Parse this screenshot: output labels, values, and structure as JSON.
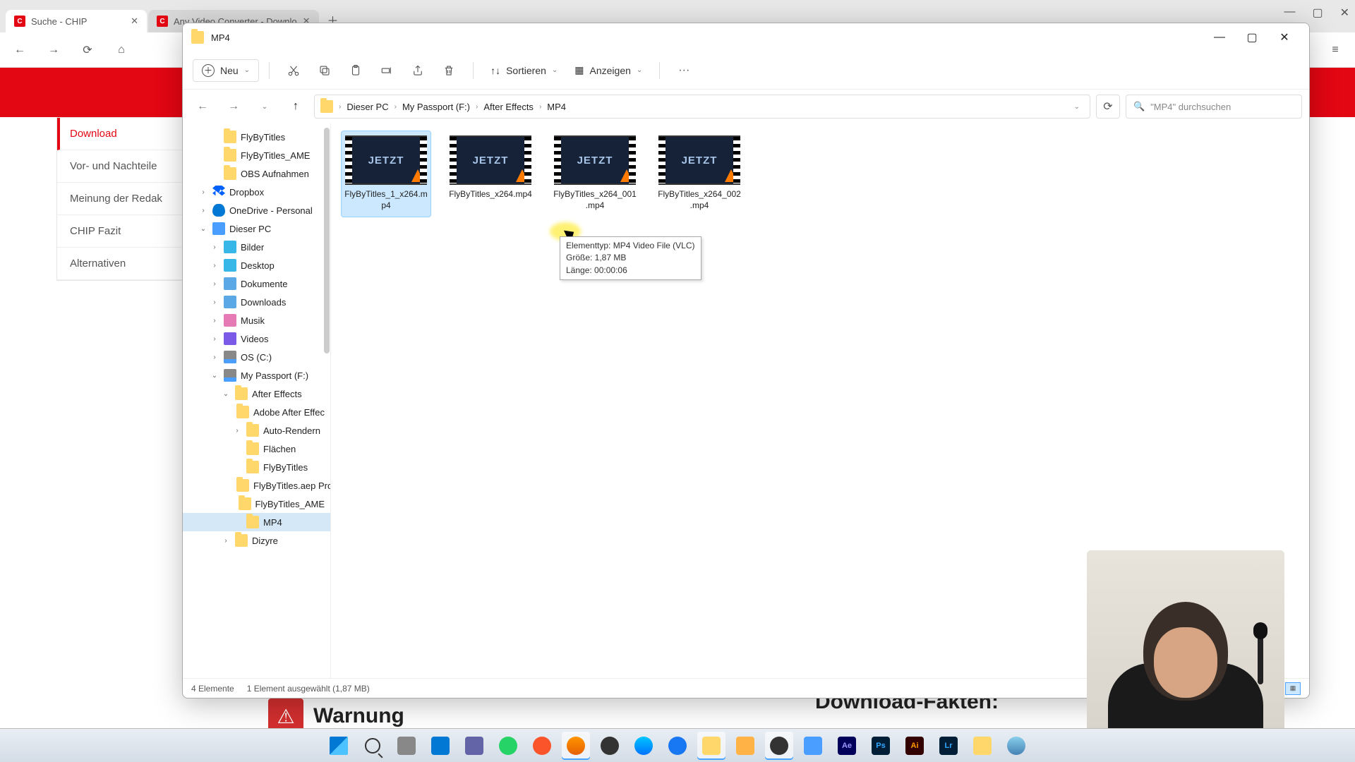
{
  "browser": {
    "tabs": [
      {
        "title": "Suche - CHIP"
      },
      {
        "title": "Any Video Converter - Downlo"
      }
    ],
    "win": {
      "min": "—",
      "max": "▢",
      "close": "✕"
    }
  },
  "page": {
    "sidebar": [
      "Download",
      "Vor- und Nachteile",
      "Meinung der Redak",
      "CHIP Fazit",
      "Alternativen"
    ],
    "warning": "Warnung",
    "facts_title": "Download-Fakten:"
  },
  "explorer": {
    "title": "MP4",
    "toolbar": {
      "new_label": "Neu",
      "sort_label": "Sortieren",
      "view_label": "Anzeigen",
      "more": "···"
    },
    "breadcrumbs": [
      "Dieser PC",
      "My Passport (F:)",
      "After Effects",
      "MP4"
    ],
    "search_placeholder": "\"MP4\" durchsuchen",
    "nav": [
      {
        "label": "FlyByTitles",
        "icon": "folder",
        "indent": 2
      },
      {
        "label": "FlyByTitles_AME",
        "icon": "folder",
        "indent": 2
      },
      {
        "label": "OBS Aufnahmen",
        "icon": "folder",
        "indent": 2
      },
      {
        "label": "Dropbox",
        "icon": "dropbox",
        "indent": 1,
        "exp": "›"
      },
      {
        "label": "OneDrive - Personal",
        "icon": "onedrive",
        "indent": 1,
        "exp": "›"
      },
      {
        "label": "Dieser PC",
        "icon": "pc",
        "indent": 1,
        "exp": "⌄"
      },
      {
        "label": "Bilder",
        "icon": "pics",
        "indent": 2,
        "exp": "›"
      },
      {
        "label": "Desktop",
        "icon": "desktop",
        "indent": 2,
        "exp": "›"
      },
      {
        "label": "Dokumente",
        "icon": "docs",
        "indent": 2,
        "exp": "›"
      },
      {
        "label": "Downloads",
        "icon": "dl",
        "indent": 2,
        "exp": "›"
      },
      {
        "label": "Musik",
        "icon": "music",
        "indent": 2,
        "exp": "›"
      },
      {
        "label": "Videos",
        "icon": "video",
        "indent": 2,
        "exp": "›"
      },
      {
        "label": "OS (C:)",
        "icon": "drive",
        "indent": 2,
        "exp": "›"
      },
      {
        "label": "My Passport (F:)",
        "icon": "drive",
        "indent": 2,
        "exp": "⌄"
      },
      {
        "label": "After Effects",
        "icon": "folder",
        "indent": 3,
        "exp": "⌄"
      },
      {
        "label": "Adobe After Effec",
        "icon": "folder",
        "indent": 4
      },
      {
        "label": "Auto-Rendern",
        "icon": "folder",
        "indent": 4,
        "exp": "›"
      },
      {
        "label": "Flächen",
        "icon": "folder",
        "indent": 4
      },
      {
        "label": "FlyByTitles",
        "icon": "folder",
        "indent": 4
      },
      {
        "label": "FlyByTitles.aep Pro",
        "icon": "folder",
        "indent": 4
      },
      {
        "label": "FlyByTitles_AME",
        "icon": "folder",
        "indent": 4
      },
      {
        "label": "MP4",
        "icon": "folder",
        "indent": 4,
        "sel": true
      },
      {
        "label": "Dizyre",
        "icon": "folder",
        "indent": 3,
        "exp": "›"
      }
    ],
    "files": [
      {
        "name": "FlyByTitles_1_x264.mp4",
        "thumb": "JETZT",
        "sel": true
      },
      {
        "name": "FlyByTitles_x264.mp4",
        "thumb": "JETZT"
      },
      {
        "name": "FlyByTitles_x264_001.mp4",
        "thumb": "JETZT"
      },
      {
        "name": "FlyByTitles_x264_002.mp4",
        "thumb": "JETZT"
      }
    ],
    "tooltip": {
      "l1": "Elementtyp: MP4 Video File (VLC)",
      "l2": "Größe: 1,87 MB",
      "l3": "Länge: 00:00:06"
    },
    "status": {
      "count": "4 Elemente",
      "selected": "1 Element ausgewählt (1,87 MB)"
    }
  }
}
